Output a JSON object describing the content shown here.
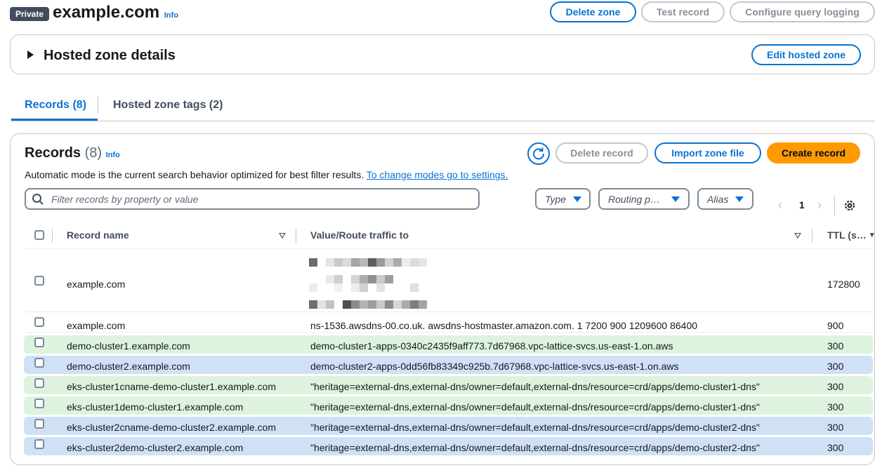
{
  "header": {
    "badge": "Private",
    "title": "example.com",
    "info": "Info",
    "delete_zone": "Delete zone",
    "test_record": "Test record",
    "configure_logging": "Configure query logging"
  },
  "details_panel": {
    "title": "Hosted zone details",
    "edit_button": "Edit hosted zone"
  },
  "tabs": [
    {
      "label": "Records (8)",
      "active": true
    },
    {
      "label": "Hosted zone tags (2)",
      "active": false
    }
  ],
  "records": {
    "title": "Records",
    "count": "(8)",
    "info": "Info",
    "delete_record": "Delete record",
    "import_zone": "Import zone file",
    "create_record": "Create record",
    "description": "Automatic mode is the current search behavior optimized for best filter results.",
    "description_link": "To change modes go to settings.",
    "search_placeholder": "Filter records by property or value",
    "filters": [
      "Type",
      "Routing p…",
      "Alias"
    ],
    "page": "1",
    "columns": [
      "Record name",
      "Value/Route traffic to",
      "TTL (s…"
    ],
    "rows": [
      {
        "name": "example.com",
        "value": "",
        "ttl": "172800",
        "color": "none"
      },
      {
        "name": "example.com",
        "value": "ns-1536.awsdns-00.co.uk. awsdns-hostmaster.amazon.com. 1 7200 900 1209600 86400",
        "ttl": "900",
        "color": "none"
      },
      {
        "name": "demo-cluster1.example.com",
        "value": "demo-cluster1-apps-0340c2435f9aff773.7d67968.vpc-lattice-svcs.us-east-1.on.aws",
        "ttl": "300",
        "color": "#ddf3de"
      },
      {
        "name": "demo-cluster2.example.com",
        "value": "demo-cluster2-apps-0dd56fb83349c925b.7d67968.vpc-lattice-svcs.us-east-1.on.aws",
        "ttl": "300",
        "color": "#d0e1f6"
      },
      {
        "name": "eks-cluster1cname-demo-cluster1.example.com",
        "value": "\"heritage=external-dns,external-dns/owner=default,external-dns/resource=crd/apps/demo-cluster1-dns\"",
        "ttl": "300",
        "color": "#ddf3de"
      },
      {
        "name": "eks-cluster1demo-cluster1.example.com",
        "value": "\"heritage=external-dns,external-dns/owner=default,external-dns/resource=crd/apps/demo-cluster1-dns\"",
        "ttl": "300",
        "color": "#ddf3de"
      },
      {
        "name": "eks-cluster2cname-demo-cluster2.example.com",
        "value": "\"heritage=external-dns,external-dns/owner=default,external-dns/resource=crd/apps/demo-cluster2-dns\"",
        "ttl": "300",
        "color": "#d0e1f6"
      },
      {
        "name": "eks-cluster2demo-cluster2.example.com",
        "value": "\"heritage=external-dns,external-dns/owner=default,external-dns/resource=crd/apps/demo-cluster2-dns\"",
        "ttl": "300",
        "color": "#d0e1f6"
      }
    ]
  },
  "colors": {
    "accent": "#0972d3",
    "primary_button": "#ff9900",
    "row_green": "#ddf3de",
    "row_blue": "#d0e1f6"
  }
}
